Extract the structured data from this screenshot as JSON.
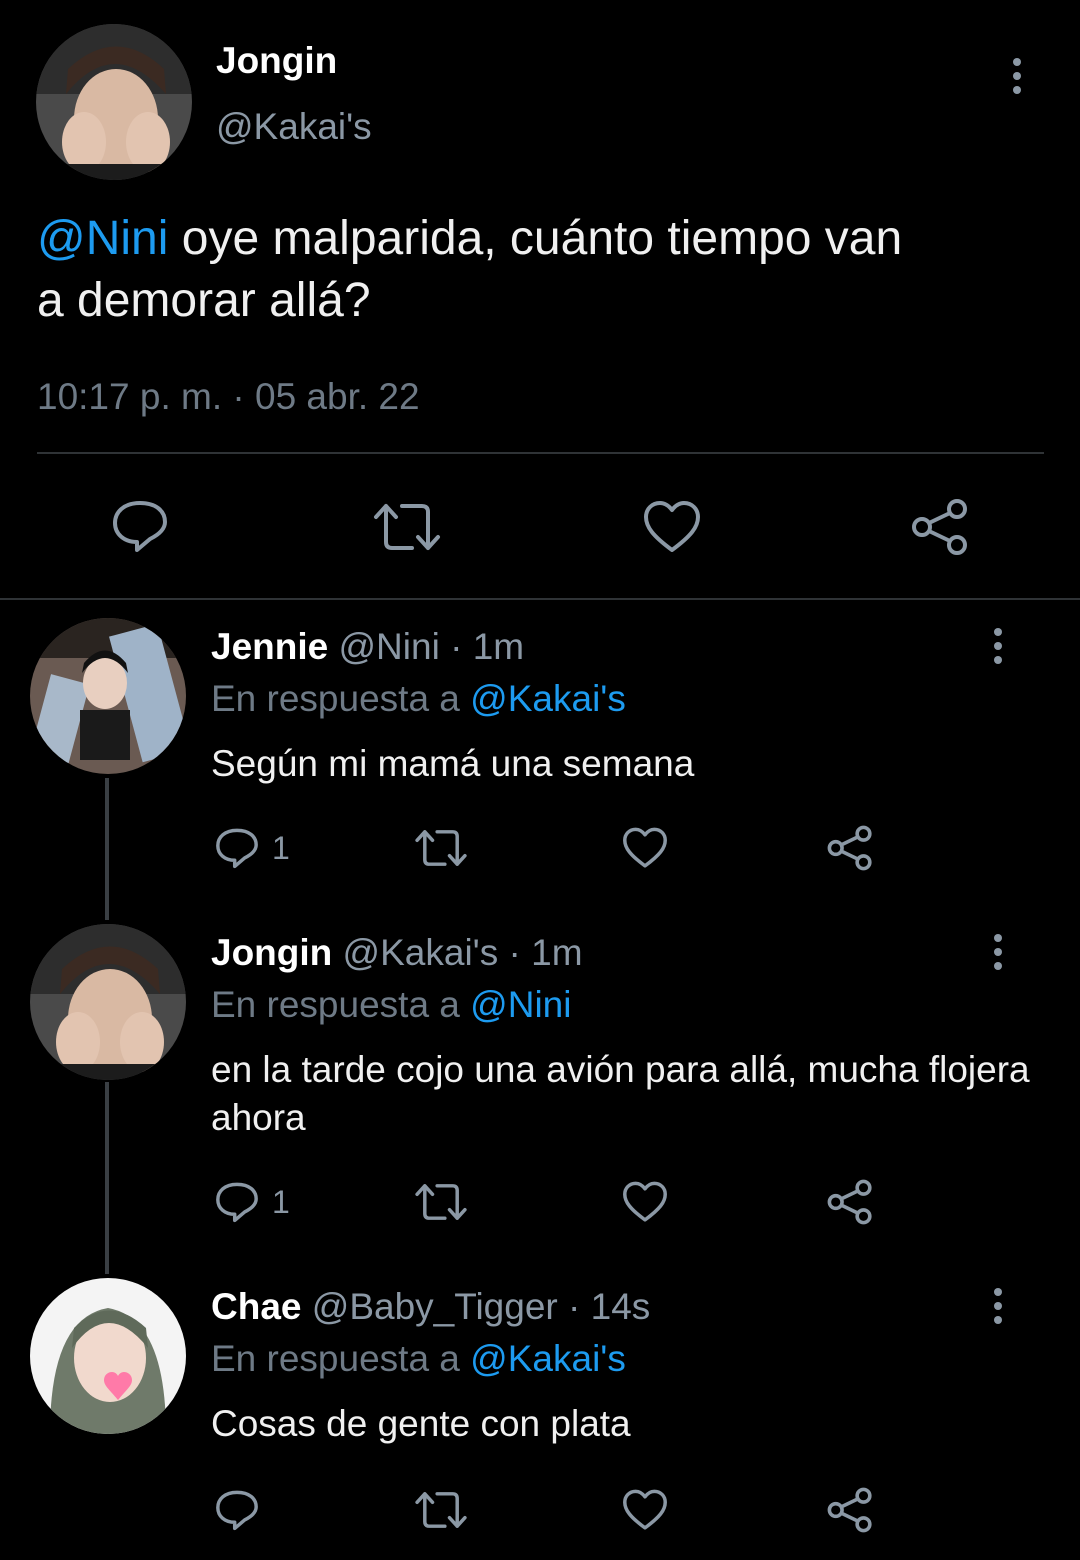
{
  "main_tweet": {
    "name": "Jongin",
    "handle": "@Kakai's",
    "mention": "@Nini",
    "text_line1": " oye malparida, cuánto tiempo van",
    "text_line2": "a demorar allá?",
    "timestamp": "10:17 p. m. · 05 abr. 22",
    "icons": [
      "reply-icon",
      "retweet-icon",
      "like-icon",
      "share-icon"
    ]
  },
  "replies": [
    {
      "name": "Jennie",
      "handle": "@Nini",
      "time": "· 1m",
      "reply_prefix": "En respuesta a ",
      "reply_to": "@Kakai's",
      "text": "Según mi mamá una semana",
      "reply_count": "1"
    },
    {
      "name": "Jongin",
      "handle": "@Kakai's",
      "time": "· 1m",
      "reply_prefix": "En respuesta a ",
      "reply_to": "@Nini",
      "text": "en la tarde cojo una avión para allá, mucha flojera ahora",
      "reply_count": "1"
    },
    {
      "name": "Chae",
      "handle": "@Baby_Tigger",
      "time": "· 14s",
      "reply_prefix": "En respuesta a ",
      "reply_to": "@Kakai's",
      "text": "Cosas de gente con plata",
      "reply_count": ""
    }
  ],
  "colors": {
    "background": "#000000",
    "accent": "#1d9bf0",
    "secondary_text": "#8b98a5",
    "divider": "#2f3336"
  }
}
